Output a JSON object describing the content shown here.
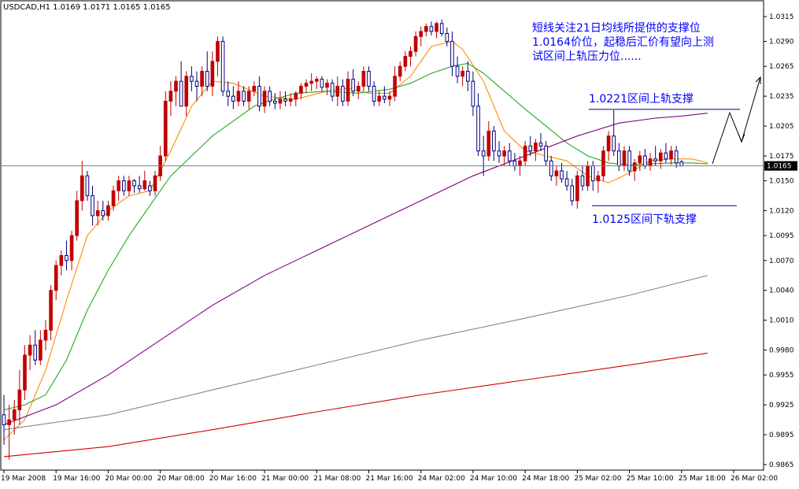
{
  "chart_data": {
    "type": "candlestick",
    "symbol_header": "USDCAD,H1  1.0169 1.0171 1.0165 1.0165",
    "symbol": "USDCAD",
    "timeframe": "H1",
    "ohlc_readout": [
      1.0169,
      1.0171,
      1.0165,
      1.0165
    ],
    "current_price": 1.0165,
    "current_price_label": "1.0165",
    "ylim": [
      0.9865,
      1.0315
    ],
    "y_ticks": [
      0.9865,
      0.9895,
      0.9925,
      0.9955,
      0.998,
      1.001,
      1.004,
      1.007,
      1.0095,
      1.012,
      1.015,
      1.0175,
      1.0205,
      1.0235,
      1.0265,
      1.029,
      1.0315
    ],
    "y_tick_labels": [
      "0.9865",
      "0.9895",
      "0.9925",
      "0.9955",
      "0.9980",
      "1.0010",
      "1.0040",
      "1.0070",
      "1.0095",
      "1.0120",
      "1.0150",
      "1.0175",
      "1.0205",
      "1.0235",
      "1.0265",
      "1.0290",
      "1.0315"
    ],
    "x_range": [
      0,
      140
    ],
    "x_ticks": [
      {
        "x": 0,
        "label": "19 Mar 2008"
      },
      {
        "x": 10,
        "label": "19 Mar 16:00"
      },
      {
        "x": 20,
        "label": "20 Mar 00:00"
      },
      {
        "x": 30,
        "label": "20 Mar 08:00"
      },
      {
        "x": 40,
        "label": "20 Mar 16:00"
      },
      {
        "x": 50,
        "label": "21 Mar 00:00"
      },
      {
        "x": 60,
        "label": "21 Mar 08:00"
      },
      {
        "x": 70,
        "label": "21 Mar 16:00"
      },
      {
        "x": 80,
        "label": "24 Mar 02:00"
      },
      {
        "x": 90,
        "label": "24 Mar 10:00"
      },
      {
        "x": 100,
        "label": "24 Mar 18:00"
      },
      {
        "x": 110,
        "label": "25 Mar 02:00"
      },
      {
        "x": 120,
        "label": "25 Mar 10:00"
      },
      {
        "x": 130,
        "label": "25 Mar 18:00"
      },
      {
        "x": 140,
        "label": "26 Mar 02:00"
      }
    ],
    "candles": [
      [
        0.9915,
        0.9935,
        0.9885,
        0.9905
      ],
      [
        0.9905,
        0.9925,
        0.987,
        0.991
      ],
      [
        0.991,
        0.993,
        0.9895,
        0.992
      ],
      [
        0.992,
        0.996,
        0.9905,
        0.994
      ],
      [
        0.994,
        0.9985,
        0.993,
        0.9975
      ],
      [
        0.9975,
        0.9995,
        0.996,
        0.9985
      ],
      [
        0.9985,
        1.0,
        0.9965,
        0.997
      ],
      [
        0.997,
        1.0,
        0.9965,
        0.999
      ],
      [
        0.999,
        1.001,
        0.998,
        1.0
      ],
      [
        1.0,
        1.0045,
        0.999,
        1.004
      ],
      [
        1.004,
        1.007,
        1.003,
        1.0065
      ],
      [
        1.0065,
        1.008,
        1.0055,
        1.0075
      ],
      [
        1.0075,
        1.009,
        1.006,
        1.007
      ],
      [
        1.007,
        1.01,
        1.006,
        1.0095
      ],
      [
        1.0095,
        1.014,
        1.009,
        1.013
      ],
      [
        1.013,
        1.017,
        1.012,
        1.0155
      ],
      [
        1.0155,
        1.016,
        1.013,
        1.0135
      ],
      [
        1.0135,
        1.0145,
        1.0105,
        1.0115
      ],
      [
        1.0115,
        1.013,
        1.0105,
        1.012
      ],
      [
        1.012,
        1.013,
        1.011,
        1.0115
      ],
      [
        1.0115,
        1.013,
        1.011,
        1.0125
      ],
      [
        1.0125,
        1.0145,
        1.012,
        1.014
      ],
      [
        1.014,
        1.0155,
        1.013,
        1.015
      ],
      [
        1.015,
        1.0155,
        1.0135,
        1.014
      ],
      [
        1.014,
        1.0155,
        1.0135,
        1.015
      ],
      [
        1.015,
        1.0152,
        1.0138,
        1.0145
      ],
      [
        1.0145,
        1.0155,
        1.0138,
        1.0142
      ],
      [
        1.0142,
        1.016,
        1.014,
        1.015
      ],
      [
        1.0145,
        1.015,
        1.0135,
        1.014
      ],
      [
        1.014,
        1.016,
        1.0135,
        1.0155
      ],
      [
        1.0155,
        1.0185,
        1.015,
        1.0175
      ],
      [
        1.0175,
        1.024,
        1.017,
        1.023
      ],
      [
        1.023,
        1.025,
        1.0215,
        1.024
      ],
      [
        1.024,
        1.0255,
        1.0225,
        1.025
      ],
      [
        1.025,
        1.027,
        1.0235,
        1.0225
      ],
      [
        1.0225,
        1.026,
        1.0215,
        1.0255
      ],
      [
        1.0255,
        1.0265,
        1.024,
        1.025
      ],
      [
        1.025,
        1.026,
        1.023,
        1.0245
      ],
      [
        1.0245,
        1.0265,
        1.0235,
        1.026
      ],
      [
        1.026,
        1.028,
        1.024,
        1.0245
      ],
      [
        1.0245,
        1.028,
        1.0235,
        1.027
      ],
      [
        1.027,
        1.0295,
        1.0255,
        1.029
      ],
      [
        1.029,
        1.0295,
        1.0235,
        1.024
      ],
      [
        1.024,
        1.025,
        1.0225,
        1.0235
      ],
      [
        1.0235,
        1.0245,
        1.0222,
        1.023
      ],
      [
        1.023,
        1.025,
        1.0225,
        1.024
      ],
      [
        1.024,
        1.0245,
        1.0225,
        1.023
      ],
      [
        1.023,
        1.0245,
        1.0222,
        1.024
      ],
      [
        1.024,
        1.025,
        1.0235,
        1.0245
      ],
      [
        1.0245,
        1.0255,
        1.022,
        1.0225
      ],
      [
        1.0225,
        1.0245,
        1.0218,
        1.024
      ],
      [
        1.024,
        1.0245,
        1.0225,
        1.023
      ],
      [
        1.023,
        1.0238,
        1.0222,
        1.0228
      ],
      [
        1.0228,
        1.024,
        1.0222,
        1.0232
      ],
      [
        1.0232,
        1.024,
        1.0225,
        1.023
      ],
      [
        1.023,
        1.0238,
        1.0225,
        1.0232
      ],
      [
        1.0232,
        1.024,
        1.0225,
        1.0238
      ],
      [
        1.0238,
        1.0248,
        1.0232,
        1.0245
      ],
      [
        1.0245,
        1.0252,
        1.0238,
        1.0248
      ],
      [
        1.0248,
        1.0258,
        1.024,
        1.025
      ],
      [
        1.025,
        1.0255,
        1.0242,
        1.0252
      ],
      [
        1.0252,
        1.0255,
        1.024,
        1.0244
      ],
      [
        1.0244,
        1.0252,
        1.0236,
        1.0248
      ],
      [
        1.0248,
        1.0252,
        1.023,
        1.0235
      ],
      [
        1.0235,
        1.0255,
        1.0225,
        1.0245
      ],
      [
        1.0245,
        1.0252,
        1.0225,
        1.023
      ],
      [
        1.023,
        1.026,
        1.0225,
        1.0252
      ],
      [
        1.0252,
        1.0262,
        1.0235,
        1.024
      ],
      [
        1.024,
        1.025,
        1.0232,
        1.0245
      ],
      [
        1.0245,
        1.0265,
        1.024,
        1.026
      ],
      [
        1.026,
        1.0265,
        1.024,
        1.0245
      ],
      [
        1.0245,
        1.025,
        1.0225,
        1.023
      ],
      [
        1.023,
        1.024,
        1.0225,
        1.0235
      ],
      [
        1.0235,
        1.0245,
        1.0228,
        1.0232
      ],
      [
        1.0232,
        1.024,
        1.0225,
        1.0235
      ],
      [
        1.0235,
        1.0265,
        1.023,
        1.0255
      ],
      [
        1.0255,
        1.027,
        1.025,
        1.0265
      ],
      [
        1.0265,
        1.028,
        1.026,
        1.0275
      ],
      [
        1.0275,
        1.0285,
        1.0265,
        1.028
      ],
      [
        1.028,
        1.03,
        1.0275,
        1.0295
      ],
      [
        1.0295,
        1.0305,
        1.0285,
        1.03
      ],
      [
        1.03,
        1.0308,
        1.0295,
        1.0305
      ],
      [
        1.0305,
        1.031,
        1.0296,
        1.03
      ],
      [
        1.03,
        1.031,
        1.0293,
        1.0308
      ],
      [
        1.0308,
        1.0312,
        1.0295,
        1.0298
      ],
      [
        1.0298,
        1.0304,
        1.0285,
        1.029
      ],
      [
        1.029,
        1.03,
        1.0255,
        1.0265
      ],
      [
        1.0265,
        1.0275,
        1.0248,
        1.0255
      ],
      [
        1.0255,
        1.0265,
        1.0245,
        1.026
      ],
      [
        1.026,
        1.027,
        1.024,
        1.025
      ],
      [
        1.025,
        1.026,
        1.0215,
        1.0225
      ],
      [
        1.0225,
        1.0238,
        1.0175,
        1.018
      ],
      [
        1.018,
        1.0195,
        1.0155,
        1.0175
      ],
      [
        1.0175,
        1.021,
        1.017,
        1.02
      ],
      [
        1.02,
        1.0205,
        1.017,
        1.018
      ],
      [
        1.018,
        1.019,
        1.0168,
        1.0175
      ],
      [
        1.0175,
        1.0185,
        1.0165,
        1.018
      ],
      [
        1.018,
        1.0188,
        1.0165,
        1.017
      ],
      [
        1.017,
        1.0178,
        1.016,
        1.0165
      ],
      [
        1.0165,
        1.0175,
        1.0155,
        1.017
      ],
      [
        1.017,
        1.019,
        1.0165,
        1.0185
      ],
      [
        1.0185,
        1.0195,
        1.0175,
        1.018
      ],
      [
        1.018,
        1.0192,
        1.017,
        1.0188
      ],
      [
        1.0188,
        1.0198,
        1.018,
        1.0185
      ],
      [
        1.0185,
        1.019,
        1.0165,
        1.017
      ],
      [
        1.017,
        1.0175,
        1.015,
        1.0155
      ],
      [
        1.0155,
        1.0165,
        1.0145,
        1.016
      ],
      [
        1.016,
        1.0168,
        1.0148,
        1.0152
      ],
      [
        1.0152,
        1.016,
        1.014,
        1.0145
      ],
      [
        1.0145,
        1.0152,
        1.0125,
        1.013
      ],
      [
        1.013,
        1.016,
        1.0122,
        1.0155
      ],
      [
        1.0155,
        1.0165,
        1.014,
        1.0145
      ],
      [
        1.0145,
        1.017,
        1.014,
        1.0165
      ],
      [
        1.0165,
        1.017,
        1.014,
        1.015
      ],
      [
        1.015,
        1.016,
        1.0138,
        1.0155
      ],
      [
        1.0155,
        1.0185,
        1.015,
        1.018
      ],
      [
        1.018,
        1.02,
        1.017,
        1.0195
      ],
      [
        1.0195,
        1.0221,
        1.0175,
        1.018
      ],
      [
        1.018,
        1.0188,
        1.016,
        1.0165
      ],
      [
        1.0165,
        1.0185,
        1.016,
        1.018
      ],
      [
        1.018,
        1.0185,
        1.0155,
        1.016
      ],
      [
        1.016,
        1.0172,
        1.015,
        1.0168
      ],
      [
        1.0168,
        1.018,
        1.016,
        1.0175
      ],
      [
        1.0175,
        1.0182,
        1.0162,
        1.0165
      ],
      [
        1.0165,
        1.0178,
        1.016,
        1.0172
      ],
      [
        1.0172,
        1.0185,
        1.0165,
        1.017
      ],
      [
        1.017,
        1.0182,
        1.0162,
        1.0178
      ],
      [
        1.0178,
        1.0188,
        1.0168,
        1.0172
      ],
      [
        1.0172,
        1.0185,
        1.0166,
        1.018
      ],
      [
        1.018,
        1.0185,
        1.0163,
        1.0168
      ],
      [
        1.0169,
        1.0171,
        1.0165,
        1.0165
      ]
    ],
    "colors": {
      "bull": "#c00000",
      "bear": "#000080",
      "ma_fast": "#ff8c00",
      "ma_21": "#22aa22",
      "ma_mid": "#800080",
      "ma_slow": "#7a8a99",
      "ma_long": "#d00000",
      "annotation_text": "#0000ff"
    },
    "series": [
      {
        "values": [
          [
            0,
            0.989
          ],
          [
            4,
            0.991
          ],
          [
            8,
            0.996
          ],
          [
            12,
            1.003
          ],
          [
            16,
            1.0095
          ],
          [
            20,
            1.012
          ],
          [
            24,
            1.0135
          ],
          [
            28,
            1.014
          ],
          [
            32,
            1.018
          ],
          [
            36,
            1.0225
          ],
          [
            40,
            1.025
          ],
          [
            44,
            1.0248
          ],
          [
            50,
            1.0235
          ],
          [
            56,
            1.0232
          ],
          [
            62,
            1.024
          ],
          [
            66,
            1.0243
          ],
          [
            70,
            1.0238
          ],
          [
            74,
            1.0238
          ],
          [
            78,
            1.0255
          ],
          [
            82,
            1.0285
          ],
          [
            86,
            1.029
          ],
          [
            88,
            1.0282
          ],
          [
            92,
            1.025
          ],
          [
            96,
            1.02
          ],
          [
            100,
            1.018
          ],
          [
            104,
            1.0175
          ],
          [
            108,
            1.017
          ],
          [
            112,
            1.0155
          ],
          [
            116,
            1.0148
          ],
          [
            120,
            1.0158
          ],
          [
            124,
            1.017
          ],
          [
            128,
            1.0172
          ],
          [
            132,
            1.0172
          ],
          [
            135,
            1.0168
          ]
        ]
      },
      {
        "values": [
          [
            0,
            0.992
          ],
          [
            4,
            0.9925
          ],
          [
            8,
            0.9935
          ],
          [
            12,
            0.997
          ],
          [
            16,
            1.002
          ],
          [
            20,
            1.006
          ],
          [
            24,
            1.0095
          ],
          [
            28,
            1.0125
          ],
          [
            32,
            1.0155
          ],
          [
            36,
            1.0175
          ],
          [
            40,
            1.0195
          ],
          [
            44,
            1.021
          ],
          [
            48,
            1.0225
          ],
          [
            52,
            1.0232
          ],
          [
            56,
            1.0238
          ],
          [
            62,
            1.024
          ],
          [
            68,
            1.0238
          ],
          [
            74,
            1.0242
          ],
          [
            78,
            1.0248
          ],
          [
            82,
            1.0258
          ],
          [
            86,
            1.0265
          ],
          [
            89,
            1.0268
          ],
          [
            92,
            1.0258
          ],
          [
            96,
            1.024
          ],
          [
            100,
            1.0222
          ],
          [
            104,
            1.0205
          ],
          [
            108,
            1.0188
          ],
          [
            112,
            1.0175
          ],
          [
            116,
            1.0168
          ],
          [
            120,
            1.0166
          ],
          [
            124,
            1.0167
          ],
          [
            128,
            1.0168
          ],
          [
            132,
            1.0168
          ],
          [
            135,
            1.0167
          ]
        ]
      },
      {
        "values": [
          [
            0,
            0.9905
          ],
          [
            10,
            0.9925
          ],
          [
            20,
            0.9955
          ],
          [
            30,
            0.999
          ],
          [
            40,
            1.0025
          ],
          [
            50,
            1.0055
          ],
          [
            60,
            1.008
          ],
          [
            70,
            1.0105
          ],
          [
            80,
            1.013
          ],
          [
            90,
            1.0155
          ],
          [
            100,
            1.0175
          ],
          [
            110,
            1.0195
          ],
          [
            118,
            1.0208
          ],
          [
            125,
            1.0213
          ],
          [
            130,
            1.0215
          ],
          [
            135,
            1.0218
          ]
        ]
      },
      {
        "values": [
          [
            0,
            0.99
          ],
          [
            20,
            0.9915
          ],
          [
            40,
            0.994
          ],
          [
            60,
            0.9965
          ],
          [
            80,
            0.999
          ],
          [
            100,
            1.0012
          ],
          [
            120,
            1.0035
          ],
          [
            135,
            1.0055
          ]
        ]
      },
      {
        "values": [
          [
            0,
            0.9873
          ],
          [
            20,
            0.9883
          ],
          [
            40,
            0.99
          ],
          [
            60,
            0.9918
          ],
          [
            80,
            0.9935
          ],
          [
            100,
            0.995
          ],
          [
            120,
            0.9965
          ],
          [
            135,
            0.9977
          ]
        ]
      }
    ],
    "annotations": {
      "note_line1": "短线关注21日均线所提供的支撑位",
      "note_line2": "1.0164价位，起稳后汇价有望向上测",
      "note_line3": "试区间上轨压力位......",
      "upper_label": "1.0221区间上轨支撑",
      "lower_label": "1.0125区间下轨支撑",
      "upper_level": 1.0221,
      "lower_level": 1.0125
    }
  }
}
